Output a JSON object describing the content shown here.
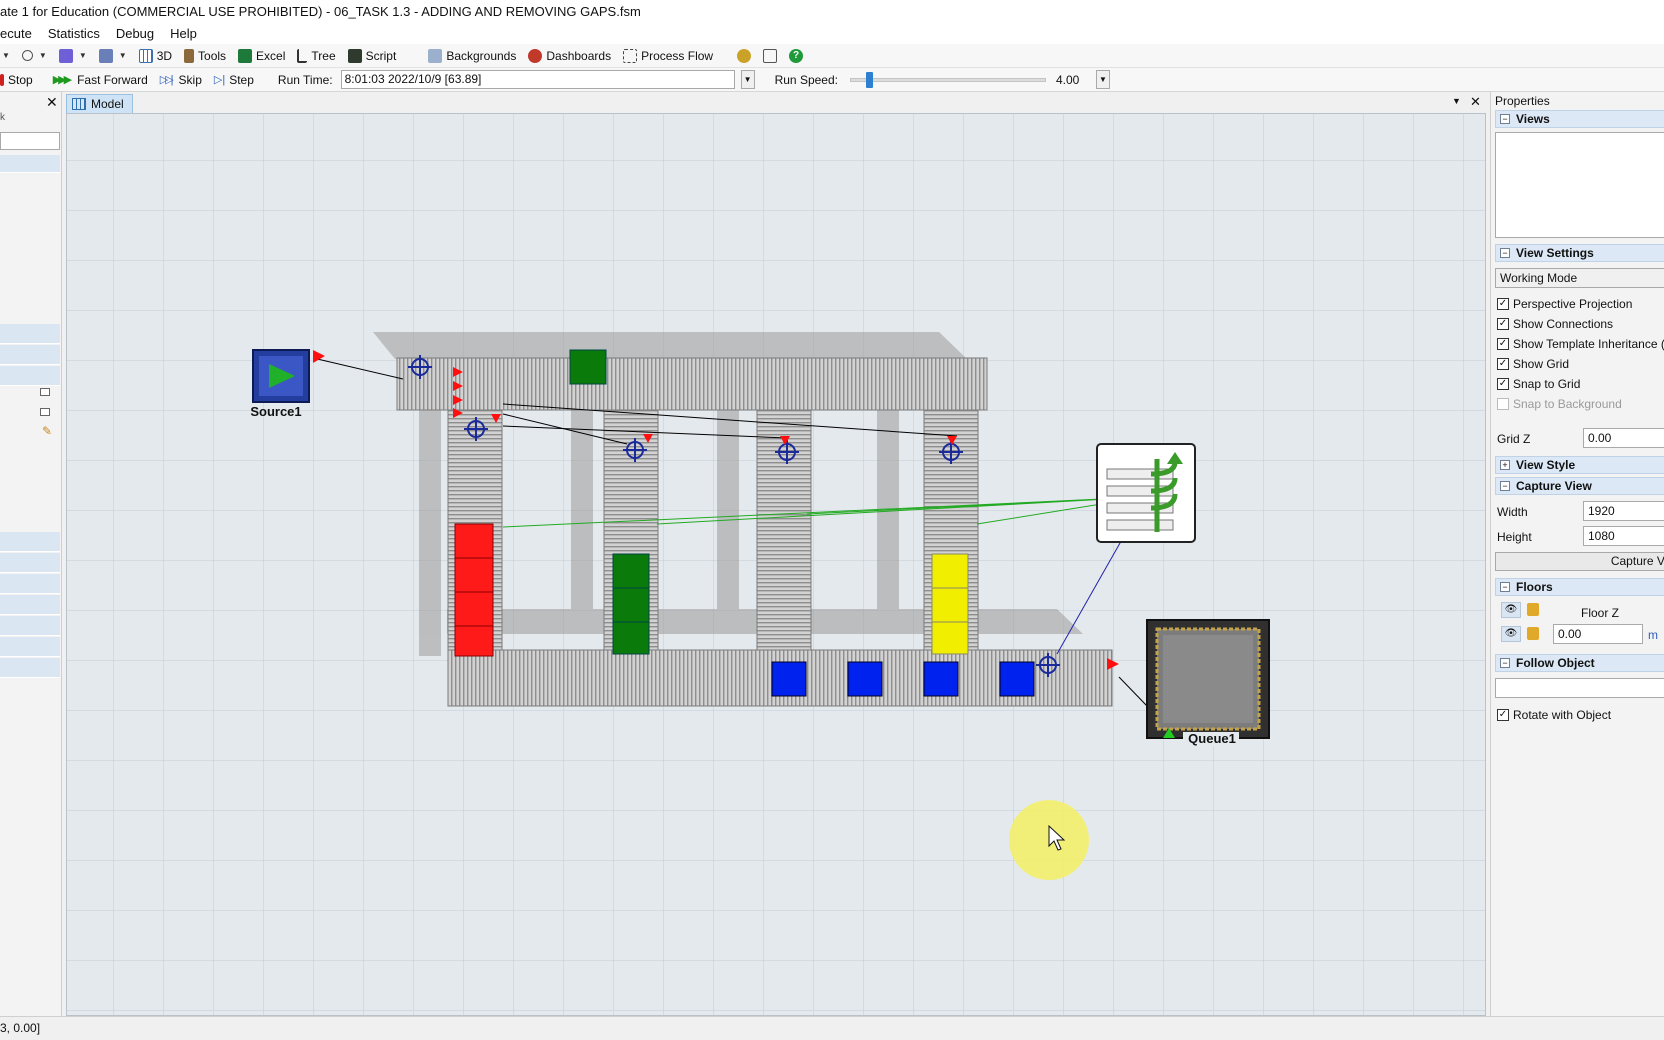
{
  "window": {
    "title": "ate 1 for Education (COMMERCIAL USE PROHIBITED) - 06_TASK 1.3 - ADDING AND REMOVING GAPS.fsm"
  },
  "menu": [
    "ecute",
    "Statistics",
    "Debug",
    "Help"
  ],
  "toolbar": {
    "view3d": "3D",
    "tools": "Tools",
    "excel": "Excel",
    "tree": "Tree",
    "script": "Script",
    "backgrounds": "Backgrounds",
    "dashboards": "Dashboards",
    "process_flow": "Process Flow"
  },
  "run": {
    "stop": "Stop",
    "fast_forward": "Fast Forward",
    "skip": "Skip",
    "step": "Step",
    "run_time_label": "Run Time:",
    "run_time_value": "8:01:03  2022/10/9  [63.89]",
    "run_speed_label": "Run Speed:",
    "run_speed_value": "4.00",
    "speed_fraction": 0.08
  },
  "model_tab": {
    "label": "Model"
  },
  "objects": {
    "source": "Source1",
    "queue": "Queue1"
  },
  "properties": {
    "title": "Properties",
    "views_header": "Views",
    "view_settings_header": "View Settings",
    "working_mode": "Working Mode",
    "checks": [
      {
        "label": "Perspective Projection",
        "checked": true,
        "enabled": true
      },
      {
        "label": "Show Connections",
        "checked": true,
        "enabled": true
      },
      {
        "label": "Show Template Inheritance (T)",
        "checked": true,
        "enabled": true
      },
      {
        "label": "Show Grid",
        "checked": true,
        "enabled": true
      },
      {
        "label": "Snap to Grid",
        "checked": true,
        "enabled": true
      },
      {
        "label": "Snap to Background",
        "checked": false,
        "enabled": false
      }
    ],
    "grid_z_label": "Grid Z",
    "grid_z_value": "0.00",
    "view_style_header": "View Style",
    "capture_view_header": "Capture View",
    "width_label": "Width",
    "width_value": "1920",
    "height_label": "Height",
    "height_value": "1080",
    "capture_button": "Capture Vie",
    "floors_header": "Floors",
    "floor_z_label": "Floor Z",
    "floor_z_value": "0.00",
    "floor_unit": "m",
    "follow_object_header": "Follow Object",
    "rotate_label": "Rotate with Object",
    "rotate_checked": true
  },
  "status": {
    "coords": "3, 0.00]"
  },
  "colors": {
    "accent": "#2d7fd1",
    "red": "#ff1a1a",
    "green": "#0a7a0a",
    "yellow": "#f2ee00",
    "blue": "#0022ee"
  }
}
